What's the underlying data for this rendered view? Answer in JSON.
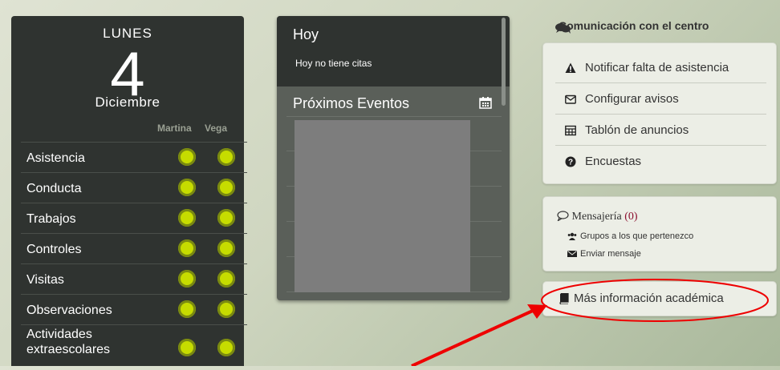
{
  "day": {
    "name": "LUNES",
    "number": "4",
    "month": "Diciembre"
  },
  "students": [
    "Martina",
    "Vega"
  ],
  "status_rows": [
    {
      "label": "Asistencia"
    },
    {
      "label": "Conducta"
    },
    {
      "label": "Trabajos"
    },
    {
      "label": "Controles"
    },
    {
      "label": "Visitas"
    },
    {
      "label": "Observaciones"
    },
    {
      "label": "Actividades\nextraescolares"
    }
  ],
  "status_color": "#c6dc00",
  "today": {
    "title": "Hoy",
    "text": "Hoy no tiene citas"
  },
  "events": {
    "title": "Próximos Eventos",
    "icon": "calendar-icon"
  },
  "communication": {
    "title": "Comunicación con el centro",
    "icon": "comments-icon",
    "items": [
      {
        "label": "Notificar falta de asistencia",
        "icon": "warning-icon"
      },
      {
        "label": "Configurar avisos",
        "icon": "envelope-outline-icon"
      },
      {
        "label": "Tablón de anuncios",
        "icon": "table-icon"
      },
      {
        "label": "Encuestas",
        "icon": "question-circle-icon"
      }
    ]
  },
  "messaging": {
    "title": "Mensajería",
    "count": "(0)",
    "icon": "comment-outline-icon",
    "links": [
      {
        "label": "Grupos a los que pertenezco",
        "icon": "users-icon"
      },
      {
        "label": "Enviar mensaje",
        "icon": "envelope-icon"
      }
    ]
  },
  "more_info": {
    "label": "Más información académica",
    "icon": "book-icon"
  },
  "annotation": {
    "color": "#ee0000"
  }
}
